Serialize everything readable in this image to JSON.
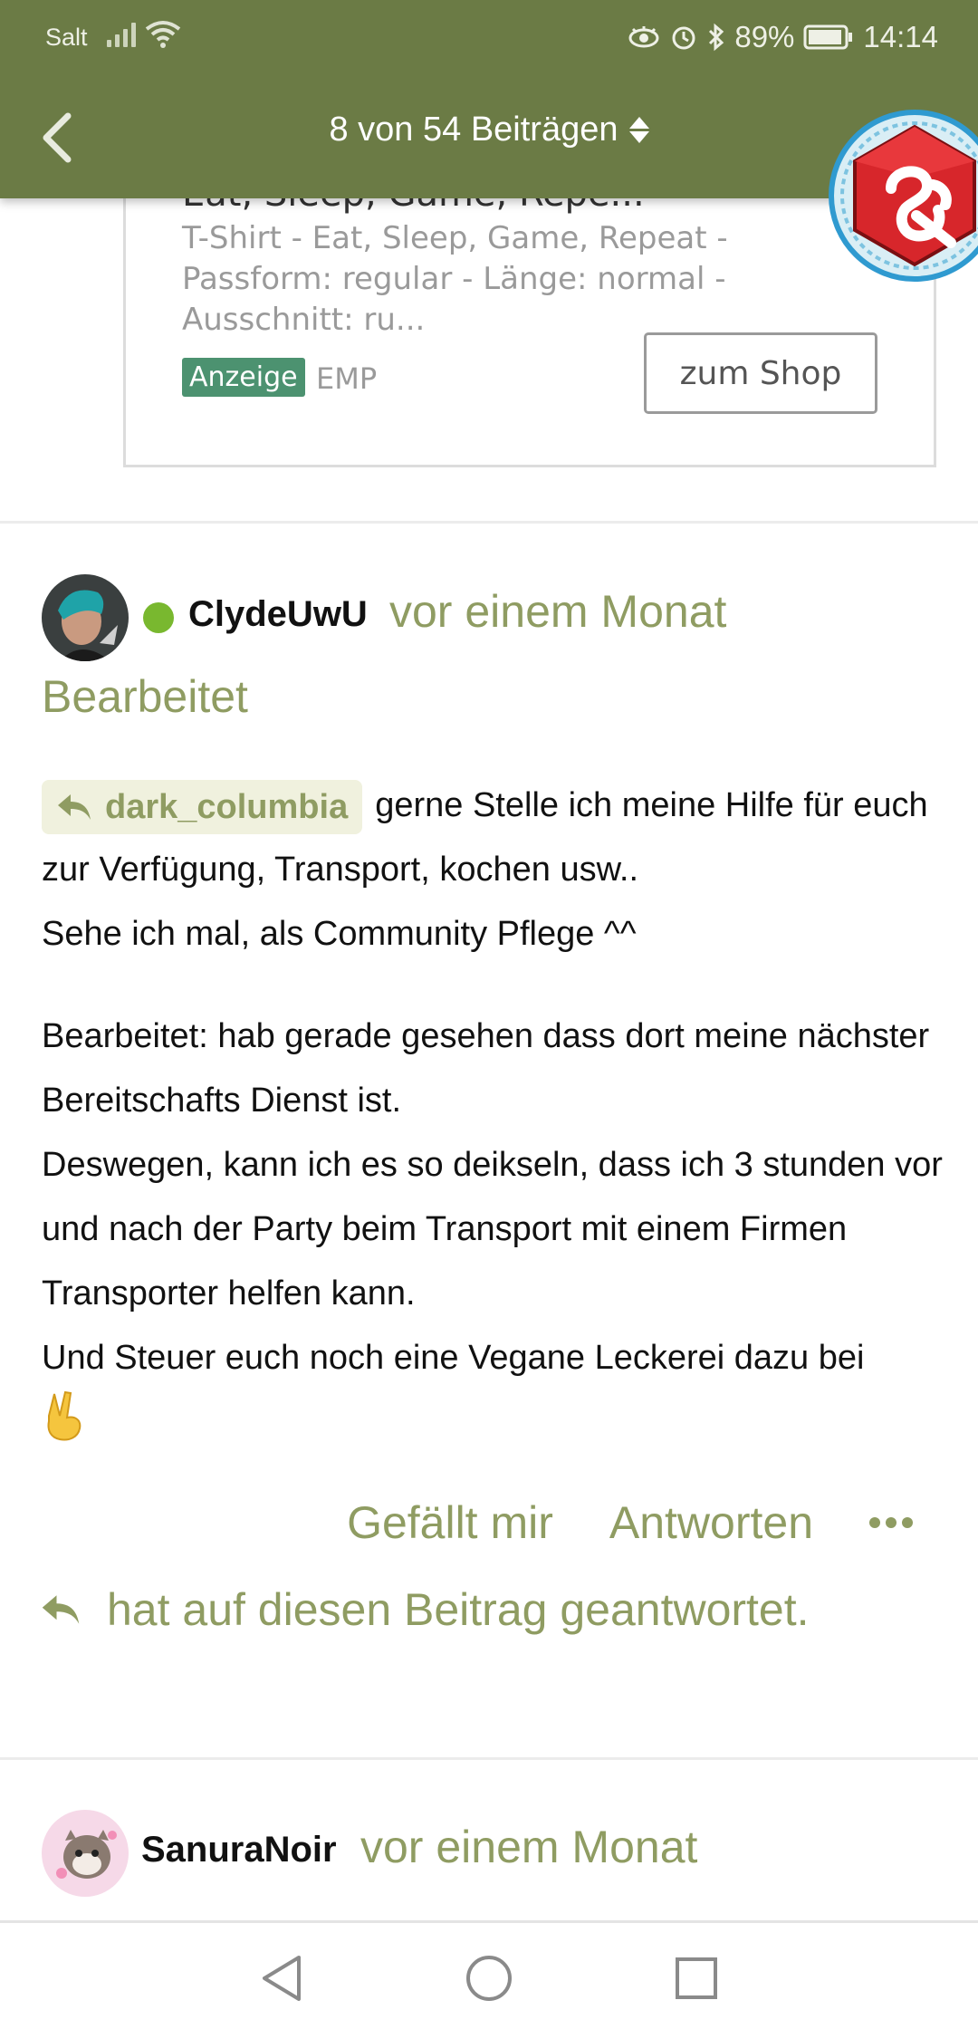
{
  "status_bar": {
    "carrier": "Salt",
    "battery": "89%",
    "time": "14:14"
  },
  "nav": {
    "title": "8 von 54 Beiträgen"
  },
  "ad": {
    "title": "Eat, Sleep, Game, Repe...",
    "description": "T-Shirt - Eat, Sleep, Game, Repeat - Passform: regular - Länge: normal - Ausschnitt: ru...",
    "badge": "Anzeige",
    "source": "EMP",
    "button": "zum Shop"
  },
  "post": {
    "author": "ClydeUwU",
    "time": "vor einem Monat",
    "edited": "Bearbeitet",
    "mention": "dark_columbia",
    "line1": "gerne Stelle ich meine Hilfe für euch zur Verfügung, Transport, kochen usw..",
    "line2": "Sehe ich mal, als Community Pflege ^^",
    "para2": "Bearbeitet: hab gerade gesehen dass dort meine nächster Bereitschafts Dienst ist.",
    "para3": "Deswegen, kann ich es so deikseln, dass ich 3 stunden vor und nach der Party beim Transport mit einem Firmen Transporter helfen kann.",
    "para4": "Und Steuer euch noch eine Vegane Leckerei dazu bei",
    "emoji": "✌",
    "like": "Gefällt mir",
    "reply": "Antworten",
    "reply_note": "hat auf diesen Beitrag geantwortet."
  },
  "next_post": {
    "author": "SanuraNoir",
    "time": "vor einem Monat"
  },
  "colors": {
    "header": "#6b7b45",
    "accent": "#8f9c62",
    "online": "#79b82f",
    "ad_badge": "#4c9270"
  }
}
